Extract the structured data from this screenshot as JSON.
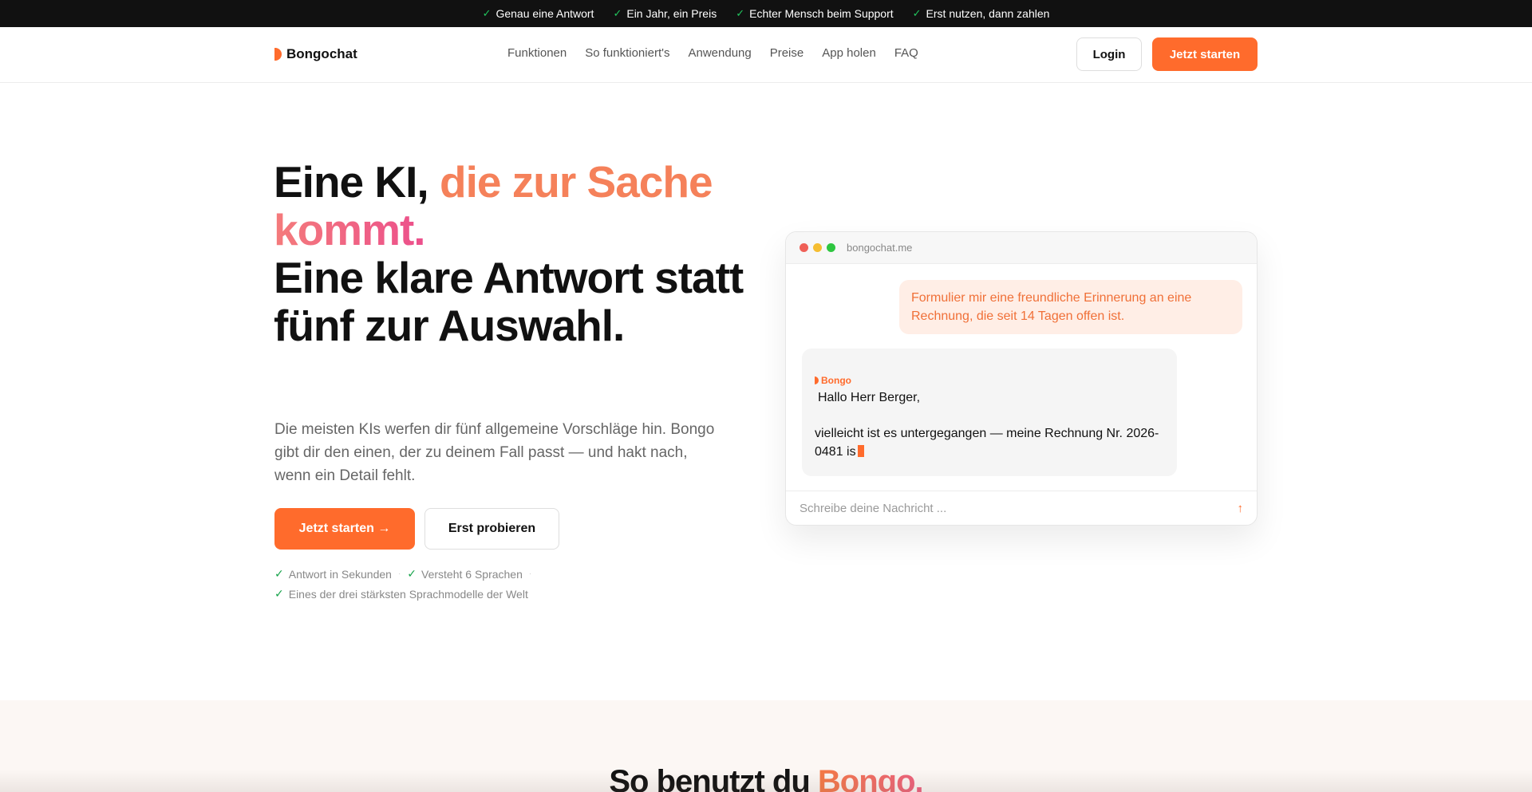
{
  "topbar": {
    "items": [
      "Genau eine Antwort",
      "Ein Jahr, ein Preis",
      "Echter Mensch beim Support",
      "Erst nutzen, dann zahlen"
    ]
  },
  "nav": {
    "brand": "Bongochat",
    "links": [
      "Funktionen",
      "So funktioniert's",
      "Anwendung",
      "Preise",
      "App holen",
      "FAQ"
    ],
    "login": "Login",
    "cta": "Jetzt starten"
  },
  "hero": {
    "title_part1": "Eine KI, ",
    "title_accent1": "die zur Sache",
    "title_accent2": "kommt.",
    "title_part2": "Eine klare Antwort statt fünf zur Auswahl.",
    "subtitle": "Die meisten KIs werfen dir fünf allgemeine Vorschläge hin. Bongo gibt dir den einen, der zu deinem Fall passt — und hakt nach, wenn ein Detail fehlt.",
    "primary_button": "Jetzt starten →",
    "secondary_button": "Erst probieren",
    "features": [
      "Antwort in Sekunden",
      "Versteht 6 Sprachen",
      "Eines der drei stärksten Sprachmodelle der Welt"
    ]
  },
  "mockup": {
    "url": "bongochat.me",
    "user_message": "Formulier mir eine freundliche Erinnerung an eine Rechnung, die seit 14 Tagen offen ist.",
    "bot_name": "Bongo",
    "bot_greeting": "Hallo Herr Berger,",
    "bot_body": "vielleicht ist es untergegangen — meine Rechnung Nr. 2026-0481 is",
    "input_placeholder": "Schreibe deine Nachricht ...",
    "send_icon": "arrow-up-icon"
  },
  "how": {
    "title_part1": "So benutzt du ",
    "title_accent": "Bongo."
  },
  "colors": {
    "accent": "#ff6b2c",
    "topbar_bg": "#111111",
    "check": "#22c55e"
  }
}
